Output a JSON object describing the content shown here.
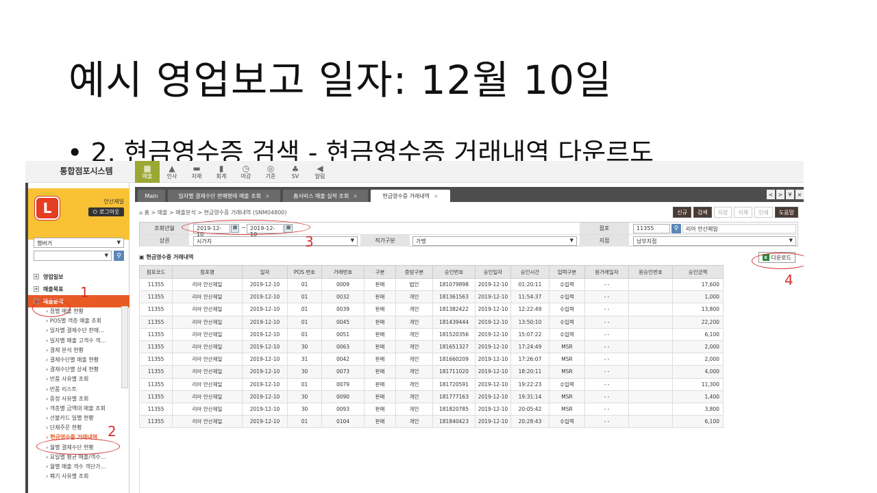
{
  "slide": {
    "title": "예시 영업보고 일자: 12월 10일",
    "bullet": "• 2. 현금영수증 검색 - 현금영수증 거래내역 다운르도"
  },
  "app": {
    "brand": "통합점포시스템",
    "menu": [
      {
        "icon": "sales-icon",
        "glyph": "▦",
        "label": "매출"
      },
      {
        "icon": "person-icon",
        "glyph": "▲",
        "label": "인사"
      },
      {
        "icon": "folder-icon",
        "glyph": "▬",
        "label": "자재"
      },
      {
        "icon": "book-icon",
        "glyph": "▮",
        "label": "회계"
      },
      {
        "icon": "clock-icon",
        "glyph": "◷",
        "label": "마감"
      },
      {
        "icon": "pin-icon",
        "glyph": "◎",
        "label": "기준"
      },
      {
        "icon": "org-icon",
        "glyph": "♣",
        "label": "SV"
      },
      {
        "icon": "speaker-icon",
        "glyph": "◀",
        "label": "알림"
      }
    ]
  },
  "sidebar": {
    "logo_text": "L",
    "user_name": "안산제일",
    "logout_label": "로그아웃",
    "store_select_value": "햄버거",
    "groups": [
      {
        "label": "영업일보"
      },
      {
        "label": "매출목표"
      },
      {
        "label": "매출분석"
      }
    ],
    "items": [
      "점별 매출 현황",
      "POS별 객층 매출 조회",
      "일자별 결제수단 판매…",
      "일자별 매출 고객수 객…",
      "결제 분석 현황",
      "결제수단별 매출 현황",
      "결제수단별 상세 현황",
      "반품 사유별 조회",
      "반품 리스트",
      "증정 사유별 조회",
      "객층별 금액대 매출 조회",
      "선불카드 일별 현황",
      "단체주문 현황",
      "현금영수증 거래내역",
      "월별 결제수단 현황",
      "요일별 평균 매출/객수…",
      "월별 매출 객수 객단가…",
      "폐기 사유별 조회"
    ]
  },
  "tabs": [
    {
      "label": "Main"
    },
    {
      "label": "일자별 결제수단 판매형태 매출 조회",
      "close": "×"
    },
    {
      "label": "홈서비스 매출 실적 조회",
      "close": "×"
    },
    {
      "label": "현금영수증 거래내역",
      "close": "×"
    }
  ],
  "tab_nav": [
    "<",
    ">",
    "¥",
    "×"
  ],
  "breadcrumb": "홈 > 매출 > 매출분석 > 현금영수증 거래내역 (SNM04800)",
  "actions": [
    {
      "label": "신규",
      "style": "dark"
    },
    {
      "label": "검색",
      "style": "dark"
    },
    {
      "label": "저장",
      "style": "light"
    },
    {
      "label": "삭제",
      "style": "light"
    },
    {
      "label": "인쇄",
      "style": "light"
    },
    {
      "label": "도움말",
      "style": "dark"
    }
  ],
  "filters": {
    "period_label": "조회년월",
    "date_from": "2019-12-10",
    "date_to": "2019-12-10",
    "date_sep": "~",
    "store_label": "점포",
    "store_code": "11355",
    "store_name": "리아 안산제일",
    "area_label": "상권",
    "area_value": "시가지",
    "direct_label": "직가구분",
    "direct_value": "가맹",
    "branch_label": "지점",
    "branch_value": "남부지점"
  },
  "section_title": "현금영수증 거래내역",
  "download_label": "다운로드",
  "table": {
    "columns": [
      "점포코드",
      "점포명",
      "일자",
      "POS 번호",
      "거래번호",
      "구분",
      "증빙구분",
      "승인번호",
      "승인일자",
      "승인시간",
      "입력구분",
      "원거래일자",
      "원승인번호",
      "승인금액"
    ],
    "rows": [
      [
        "11355",
        "리아 안산제일",
        "2019-12-10",
        "01",
        "0009",
        "판매",
        "법인",
        "181079898",
        "2019-12-10",
        "01:20:11",
        "수입력",
        "- -",
        "",
        "17,600"
      ],
      [
        "11355",
        "리아 안산제일",
        "2019-12-10",
        "01",
        "0032",
        "판매",
        "개인",
        "181361563",
        "2019-12-10",
        "11:54:37",
        "수입력",
        "- -",
        "",
        "1,000"
      ],
      [
        "11355",
        "리아 안산제일",
        "2019-12-10",
        "01",
        "0039",
        "판매",
        "개인",
        "181382422",
        "2019-12-10",
        "12:22:49",
        "수입력",
        "- -",
        "",
        "13,800"
      ],
      [
        "11355",
        "리아 안산제일",
        "2019-12-10",
        "01",
        "0045",
        "판매",
        "개인",
        "181439444",
        "2019-12-10",
        "13:50:10",
        "수입력",
        "- -",
        "",
        "22,200"
      ],
      [
        "11355",
        "리아 안산제일",
        "2019-12-10",
        "01",
        "0051",
        "판매",
        "개인",
        "181520356",
        "2019-12-10",
        "15:07:22",
        "수입력",
        "- -",
        "",
        "6,100"
      ],
      [
        "11355",
        "리아 안산제일",
        "2019-12-10",
        "30",
        "0063",
        "판매",
        "개인",
        "181651327",
        "2019-12-10",
        "17:24:49",
        "MSR",
        "- -",
        "",
        "2,000"
      ],
      [
        "11355",
        "리아 안산제일",
        "2019-12-10",
        "31",
        "0042",
        "판매",
        "개인",
        "181660209",
        "2019-12-10",
        "17:26:07",
        "MSR",
        "- -",
        "",
        "2,000"
      ],
      [
        "11355",
        "리아 안산제일",
        "2019-12-10",
        "30",
        "0073",
        "판매",
        "개인",
        "181711020",
        "2019-12-10",
        "18:20:11",
        "MSR",
        "- -",
        "",
        "4,000"
      ],
      [
        "11355",
        "리아 안산제일",
        "2019-12-10",
        "01",
        "0079",
        "판매",
        "개인",
        "181720591",
        "2019-12-10",
        "19:22:23",
        "수입력",
        "- -",
        "",
        "11,300"
      ],
      [
        "11355",
        "리아 안산제일",
        "2019-12-10",
        "30",
        "0090",
        "판매",
        "개인",
        "181777163",
        "2019-12-10",
        "19:31:14",
        "MSR",
        "- -",
        "",
        "1,400"
      ],
      [
        "11355",
        "리아 안산제일",
        "2019-12-10",
        "30",
        "0093",
        "판매",
        "개인",
        "181820785",
        "2019-12-10",
        "20:05:42",
        "MSR",
        "- -",
        "",
        "3,800"
      ],
      [
        "11355",
        "리아 안산제일",
        "2019-12-10",
        "01",
        "0104",
        "판매",
        "개인",
        "181840423",
        "2019-12-10",
        "20:28:43",
        "수입력",
        "- -",
        "",
        "6,100"
      ]
    ]
  },
  "annotations": [
    "1",
    "2",
    "3",
    "4"
  ],
  "colors": {
    "menu_active": "#9aa833",
    "group_active": "#e85a23",
    "user_box": "#f8c234",
    "logo": "#e53d22",
    "annotation": "#d43030"
  }
}
